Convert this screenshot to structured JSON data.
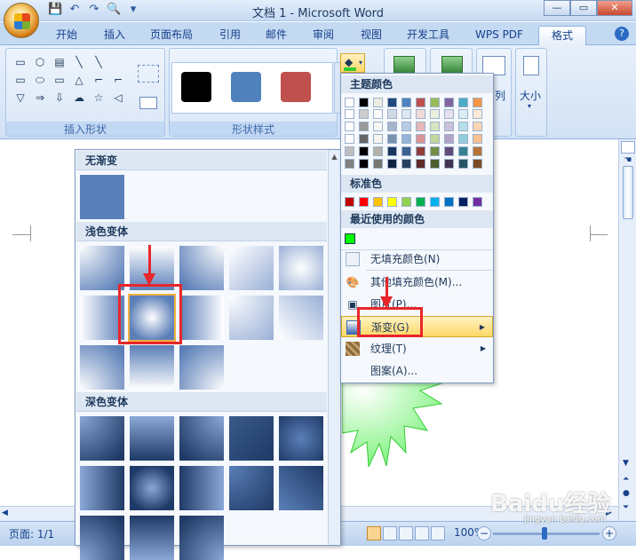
{
  "app": {
    "title": "文档 1 - Microsoft Word",
    "help": "?"
  },
  "window": {
    "minimize": "—",
    "restore": "▭",
    "close": "✕"
  },
  "qat": [
    "💾",
    "↶",
    "↷",
    "🔍",
    "▾"
  ],
  "tabs": [
    "开始",
    "插入",
    "页面布局",
    "引用",
    "邮件",
    "审阅",
    "视图",
    "开发工具",
    "WPS PDF",
    "格式"
  ],
  "ribbon": {
    "groups": [
      "插入形状",
      "形状样式"
    ],
    "shapes": [
      "▭",
      "⬡",
      "▤",
      "╲",
      "╲",
      "",
      "▭",
      "⬭",
      "▭",
      "△",
      "⌐",
      "⌐",
      "▽",
      "⇒",
      "⇩",
      "☁",
      "☆",
      "◁",
      "⌒",
      "⌒"
    ],
    "swatch_colors": [
      "#000000",
      "#4f81bd",
      "#c0504d"
    ],
    "right_label": "大小",
    "partial_label": "列"
  },
  "gallery": {
    "no_gradient": "无渐变",
    "light_variants": "浅色变体",
    "dark_variants": "深色变体"
  },
  "menu": {
    "theme_colors": "主题颜色",
    "standard_colors": "标准色",
    "recent_colors": "最近使用的颜色",
    "no_fill": "无填充颜色(N)",
    "more_colors": "其他填充颜色(M)...",
    "picture": "图片(P)...",
    "gradient": "渐变(G)",
    "texture": "纹理(T)",
    "pattern": "图案(A)...",
    "theme_palette": [
      "#ffffff",
      "#000000",
      "#eeece1",
      "#1f497d",
      "#4f81bd",
      "#c0504d",
      "#9bbb59",
      "#8064a2",
      "#4bacc6",
      "#f79646"
    ],
    "standard_palette": [
      "#c00000",
      "#ff0000",
      "#ffc000",
      "#ffff00",
      "#92d050",
      "#00b050",
      "#00b0f0",
      "#0070c0",
      "#002060",
      "#7030a0"
    ],
    "recent_palette": [
      "#00ff00"
    ]
  },
  "status": {
    "page": "页面: 1/1",
    "zoom": "100%"
  },
  "watermark": {
    "brand": "Baidu经验",
    "url": "jingyan.baidu.com"
  }
}
